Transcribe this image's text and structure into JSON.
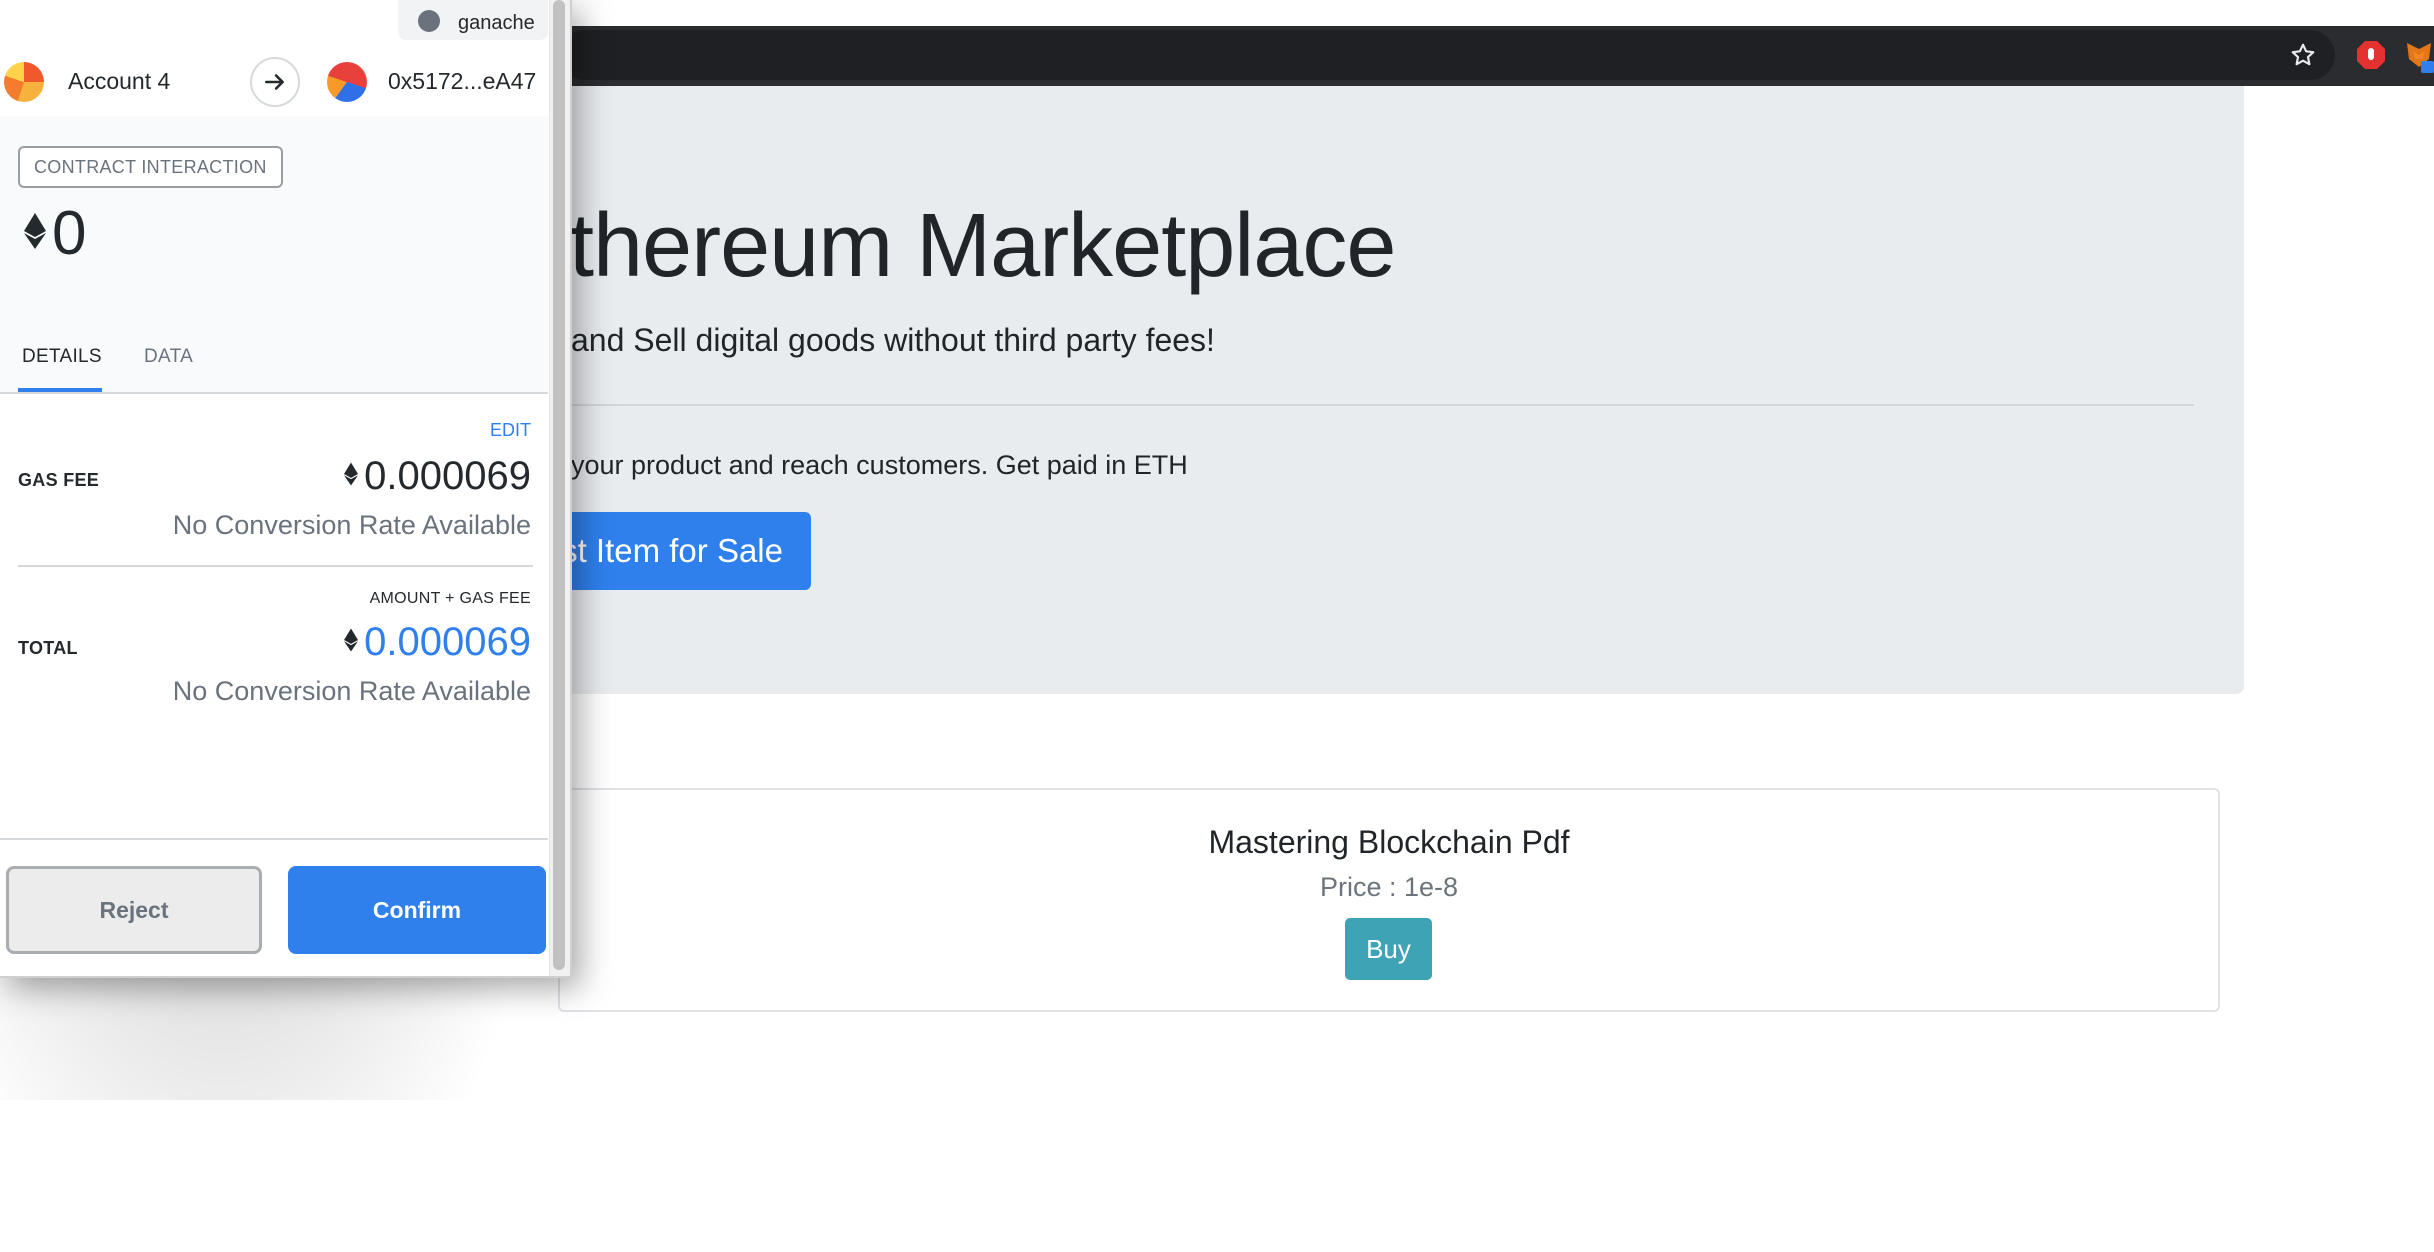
{
  "browser": {
    "toolbar_icons": [
      "star-icon",
      "adblock-icon",
      "metamask-fox-icon"
    ]
  },
  "page": {
    "hero": {
      "title": "thereum Marketplace",
      "lead": "and Sell digital goods without third party fees!",
      "text": "your product and reach customers. Get paid in ETH",
      "button_label": "st Item for Sale"
    },
    "product": {
      "name": "Mastering Blockchain Pdf",
      "price": "Price : 1e-8",
      "buy_label": "Buy"
    }
  },
  "metamask": {
    "network": "ganache",
    "from_account": "Account 4",
    "to_address": "0x5172...eA47",
    "badge": "CONTRACT INTERACTION",
    "value": "0",
    "tabs": [
      {
        "label": "DETAILS",
        "active": true
      },
      {
        "label": "DATA",
        "active": false
      }
    ],
    "edit_label": "EDIT",
    "gas_fee_label": "GAS FEE",
    "gas_fee": "0.000069",
    "gas_fee_conversion": "No Conversion Rate Available",
    "amount_gas_caption": "AMOUNT + GAS FEE",
    "total_label": "TOTAL",
    "total": "0.000069",
    "total_conversion": "No Conversion Rate Available",
    "reject_label": "Reject",
    "confirm_label": "Confirm"
  },
  "colors": {
    "primary": "#2f80ed",
    "info": "#3fa3b6",
    "jumbotron_bg": "#e9ecef"
  }
}
